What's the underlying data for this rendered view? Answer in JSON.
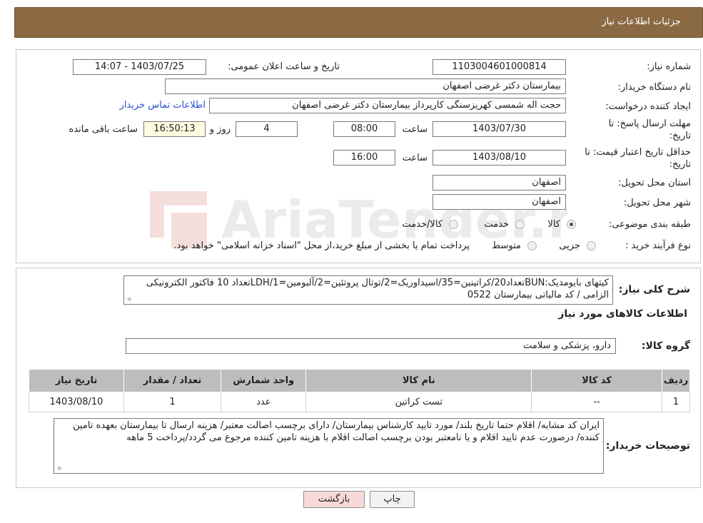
{
  "header": {
    "title": "جزئیات اطلاعات نیاز"
  },
  "labels": {
    "need_number": "شماره نیاز:",
    "announce_datetime": "تاریخ و ساعت اعلان عمومی:",
    "buyer_org": "نام دستگاه خریدار:",
    "requester": "ایجاد کننده درخواست:",
    "contact_link": "اطلاعات تماس خریدار",
    "deadline": "مهلت ارسال پاسخ: تا",
    "deadline_date": "تاریخ:",
    "time": "ساعت",
    "days_and": "روز و",
    "remaining": "ساعت باقی مانده",
    "validity": "حداقل تاریخ اعتبار قیمت: تا",
    "validity_date": "تاریخ:",
    "province": "استان محل تحویل:",
    "city": "شهر محل تحویل:",
    "category": "طبقه بندی موضوعی:",
    "purchase_type": "نوع فرآیند خرید :",
    "general_desc": "شرح کلی نیاز:",
    "goods_info": "اطلاعات کالاهای مورد نیاز",
    "goods_group": "گروه کالا:",
    "buyer_notes": "توضیحات خریدار:"
  },
  "values": {
    "need_number": "1103004601000814",
    "announce_datetime": "1403/07/25 - 14:07",
    "buyer_org": "بیمارستان دکتر غرضی اصفهان",
    "requester": "حجت اله شمسی کهریزسنگی کارپرداز بیمارستان دکتر غرضی اصفهان",
    "deadline_date": "1403/07/30",
    "deadline_time": "08:00",
    "days": "4",
    "remaining_time": "16:50:13",
    "validity_date": "1403/08/10",
    "validity_time": "16:00",
    "province": "اصفهان",
    "city": "اصفهان",
    "goods_group": "دارو، پزشکی و سلامت",
    "general_desc": "کیتهای بایومدیک:BUNتعداد20/کراتینین=35/اسیداوریک=2/توتال پروتئین=2/آلبومین=LDH/1تعداد 10 فاکتور الکترونیکی الزامی / کد مالیاتی بیمارستان 0522",
    "buyer_notes": "ایران کد مشابه/ اقلام حتما تاریخ بلند/ مورد تایید کارشناس بیمارستان/ دارای برچسب اصالت معتبر/ هزینه ارسال تا بیمارستان بعهده تامین کننده/ درصورت عدم تایید اقلام و یا نامعتبر بودن برچسب اصالت اقلام با هزینه تامین کننده مرجوع می گردد/پرداخت 5 ماهه"
  },
  "category_options": [
    {
      "label": "کالا",
      "selected": true
    },
    {
      "label": "خدمت",
      "selected": false
    },
    {
      "label": "کالا/خدمت",
      "selected": false
    }
  ],
  "purchase_options": [
    {
      "label": "جزیی",
      "selected": false
    },
    {
      "label": "متوسط",
      "selected": false
    }
  ],
  "purchase_note": "پرداخت تمام یا بخشی از مبلغ خرید،از محل \"اسناد خزانه اسلامی\" خواهد بود.",
  "table": {
    "headers": [
      "ردیف",
      "کد کالا",
      "نام کالا",
      "واحد شمارش",
      "تعداد / مقدار",
      "تاریخ نیاز"
    ],
    "rows": [
      [
        "1",
        "--",
        "تست کراتین",
        "عدد",
        "1",
        "1403/08/10"
      ]
    ]
  },
  "buttons": {
    "print": "چاپ",
    "back": "بازگشت"
  },
  "watermark": {
    "text": "AriaTender.neT"
  },
  "colors": {
    "header_bg": "#8b6a43",
    "link": "#2c4fc9",
    "back_button": "#f7d9d9"
  }
}
